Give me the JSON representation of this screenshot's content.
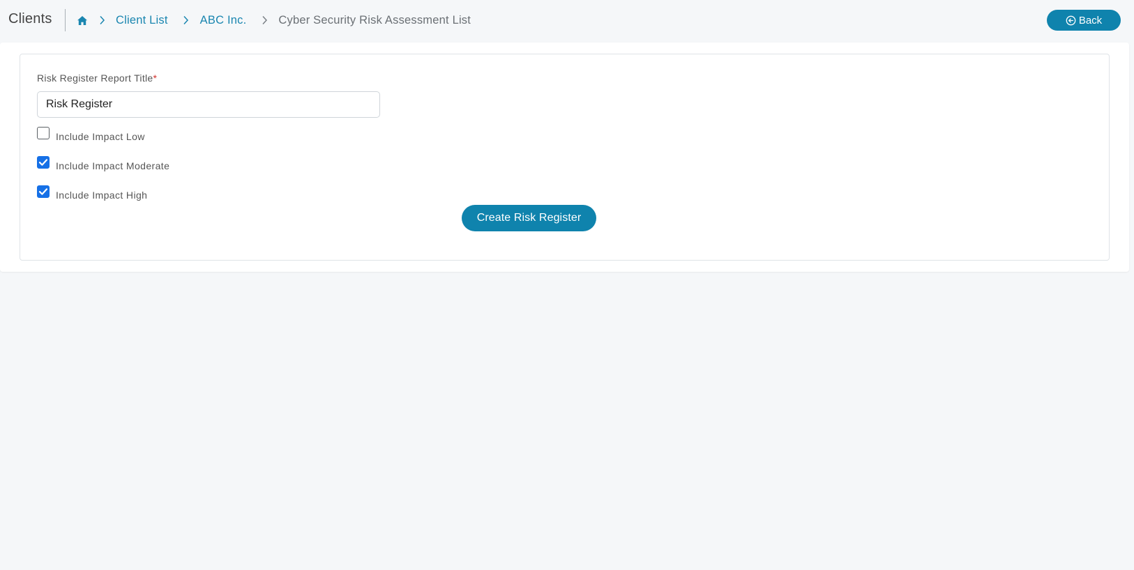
{
  "header": {
    "title": "Clients",
    "breadcrumb": {
      "home_icon": "home-icon",
      "separator_icon": "chevron-right-icon",
      "items": [
        {
          "label": "Client List",
          "link": true
        },
        {
          "label": "ABC Inc.",
          "link": true
        },
        {
          "label": "Cyber Security Risk Assessment List",
          "link": false
        }
      ]
    },
    "back_button": {
      "icon": "arrow-left-circle-icon",
      "label": "Back"
    }
  },
  "form": {
    "title_field": {
      "label": "Risk Register Report Title",
      "required_marker": "*",
      "value": "Risk Register",
      "placeholder": ""
    },
    "checkboxes": [
      {
        "label": "Include Impact Low",
        "checked": false
      },
      {
        "label": "Include Impact Moderate",
        "checked": true
      },
      {
        "label": "Include Impact High",
        "checked": true
      }
    ],
    "submit_label": "Create Risk Register"
  },
  "colors": {
    "accent": "#0f83ad",
    "link": "#1a86b0",
    "checkbox_checked": "#1670e6",
    "required": "#d0312d",
    "page_background": "#f5f7f9"
  }
}
